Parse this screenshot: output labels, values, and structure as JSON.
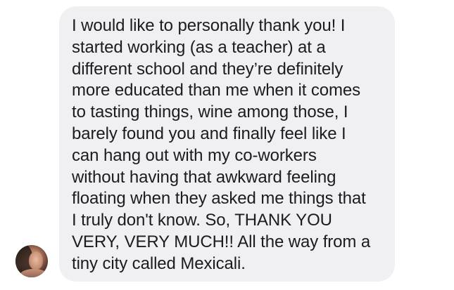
{
  "message": {
    "text": "I would like to personally thank you! I\nstarted working (as a teacher) at a\ndifferent school and they’re definitely\nmore educated than me when it comes\nto tasting things, wine among those, I\nbarely found you and finally feel like I\ncan hang out with my co-workers\nwithout having that awkward feeling\nfloating when they asked me things that\nI truly don't know. So, THANK YOU\nVERY, VERY MUCH!! All the way from a\ntiny city called Mexicali.",
    "bubble_color": "#f0f0f2",
    "text_color": "#1c1c1e"
  },
  "sender": {
    "avatar_icon": "avatar-photo"
  }
}
